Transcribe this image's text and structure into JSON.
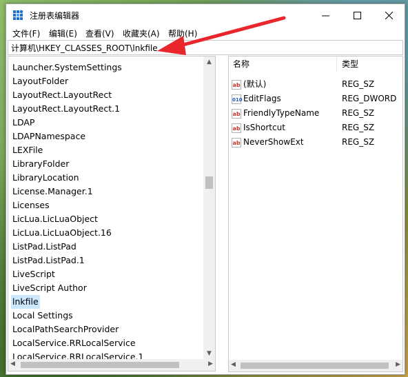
{
  "window": {
    "title": "注册表编辑器",
    "minimize": "minimize",
    "maximize": "maximize",
    "close": "close"
  },
  "menu": [
    "文件(F)",
    "编辑(E)",
    "查看(V)",
    "收藏夹(A)",
    "帮助(H)"
  ],
  "address": "计算机\\HKEY_CLASSES_ROOT\\lnkfile",
  "tree": {
    "items": [
      "Launcher.SystemSettings",
      "LayoutFolder",
      "LayoutRect.LayoutRect",
      "LayoutRect.LayoutRect.1",
      "LDAP",
      "LDAPNamespace",
      "LEXFile",
      "LibraryFolder",
      "LibraryLocation",
      "License.Manager.1",
      "Licenses",
      "LicLua.LicLuaObject",
      "LicLua.LicLuaObject.16",
      "ListPad.ListPad",
      "ListPad.ListPad.1",
      "LiveScript",
      "LiveScript Author",
      "lnkfile",
      "Local Settings",
      "LocalPathSearchProvider",
      "LocalService.RRLocalService",
      "LocalService.RRLocalService.1"
    ],
    "selected": "lnkfile"
  },
  "values": {
    "headers": {
      "name": "名称",
      "type": "类型"
    },
    "rows": [
      {
        "name": "(默认)",
        "type": "REG_SZ",
        "icon": "string-value-icon"
      },
      {
        "name": "EditFlags",
        "type": "REG_DWORD",
        "icon": "binary-value-icon"
      },
      {
        "name": "FriendlyTypeName",
        "type": "REG_SZ",
        "icon": "string-value-icon"
      },
      {
        "name": "IsShortcut",
        "type": "REG_SZ",
        "icon": "string-value-icon"
      },
      {
        "name": "NeverShowExt",
        "type": "REG_SZ",
        "icon": "string-value-icon"
      }
    ]
  },
  "icon_labels": {
    "string": "ab",
    "binary": "010"
  },
  "colors": {
    "annotation_arrow": "#e8262b",
    "selection": "#cce8ff"
  }
}
